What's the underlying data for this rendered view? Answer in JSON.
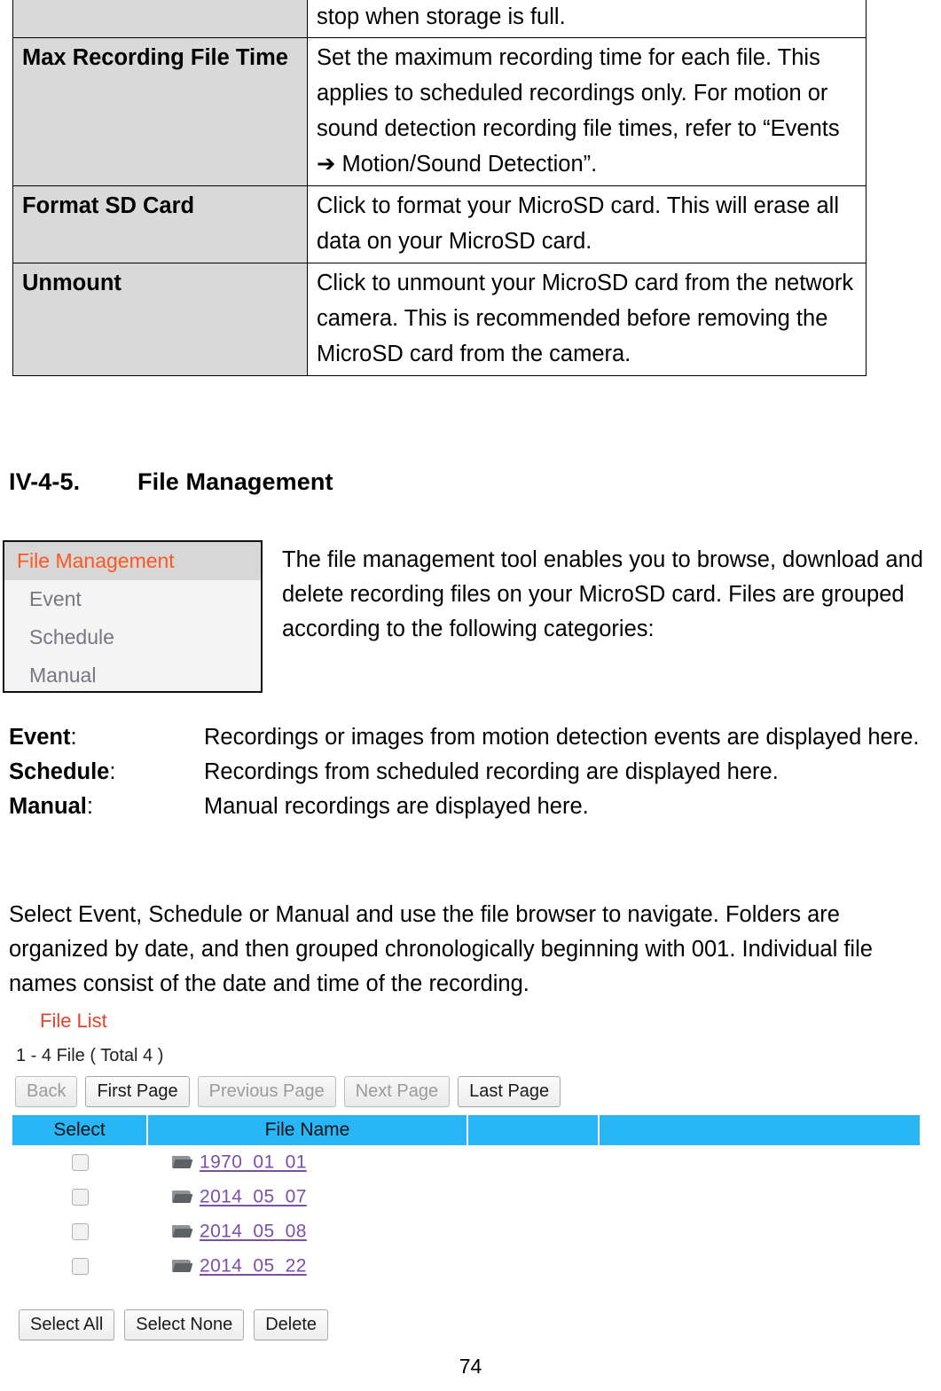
{
  "reference_table": {
    "rows": [
      {
        "term": "",
        "description": "stop when storage is full.",
        "partial_top_row": true
      },
      {
        "term": "Max Recording File Time",
        "description": "Set the maximum recording time for each file. This applies to scheduled recordings only. For motion or sound detection recording file times, refer to “Events ➔ Motion/Sound Detection”."
      },
      {
        "term": "Format SD Card",
        "description": "Click to format your MicroSD card. This will erase all data on your MicroSD card."
      },
      {
        "term": "Unmount",
        "description": "Click to unmount your MicroSD card from the network camera. This is recommended before removing the MicroSD card from the camera."
      }
    ]
  },
  "section": {
    "number": "IV-4-5.",
    "title": "File Management"
  },
  "sidebar": {
    "items": [
      {
        "label": "File Management",
        "active": true
      },
      {
        "label": "Event",
        "active": false
      },
      {
        "label": "Schedule",
        "active": false
      },
      {
        "label": "Manual",
        "active": false
      }
    ],
    "active_color": "#ff5722",
    "active_background": "#d7d7d7"
  },
  "intro_paragraph": "The file management tool enables you to browse, download and delete recording files on your MicroSD card. Files are grouped according to the following categories:",
  "definitions": [
    {
      "term": "Event",
      "colon": ":",
      "description": "Recordings or images from motion detection events are displayed here."
    },
    {
      "term": "Schedule",
      "colon": ":",
      "description": "Recordings from scheduled recording are displayed here."
    },
    {
      "term": "Manual",
      "colon": ":",
      "description": "Manual recordings are displayed here."
    }
  ],
  "closing_paragraph": "Select Event, Schedule or Manual and use the file browser to navigate. Folders are organized by date, and then grouped chronologically beginning with 001. Individual file names consist of the date and time of the recording.",
  "file_list": {
    "title": "File List",
    "title_color": "#e8412a",
    "count_text": "1 - 4 File ( Total 4 )",
    "pagination_buttons": [
      {
        "label": "Back",
        "disabled": true
      },
      {
        "label": "First Page",
        "disabled": false
      },
      {
        "label": "Previous Page",
        "disabled": true
      },
      {
        "label": "Next Page",
        "disabled": true
      },
      {
        "label": "Last Page",
        "disabled": false
      }
    ],
    "header_color": "#29b6f6",
    "columns": [
      {
        "label": "Select"
      },
      {
        "label": "File Name"
      },
      {
        "label": ""
      },
      {
        "label": ""
      }
    ],
    "rows": [
      {
        "checked": false,
        "icon": "folder-icon",
        "name": "1970_01_01"
      },
      {
        "checked": false,
        "icon": "folder-icon",
        "name": "2014_05_07"
      },
      {
        "checked": false,
        "icon": "folder-icon",
        "name": "2014_05_08"
      },
      {
        "checked": false,
        "icon": "folder-icon",
        "name": "2014_05_22"
      }
    ],
    "link_color": "#7b4fa8",
    "action_buttons": [
      {
        "label": "Select All"
      },
      {
        "label": "Select None"
      },
      {
        "label": "Delete"
      }
    ]
  },
  "page_number": "74"
}
